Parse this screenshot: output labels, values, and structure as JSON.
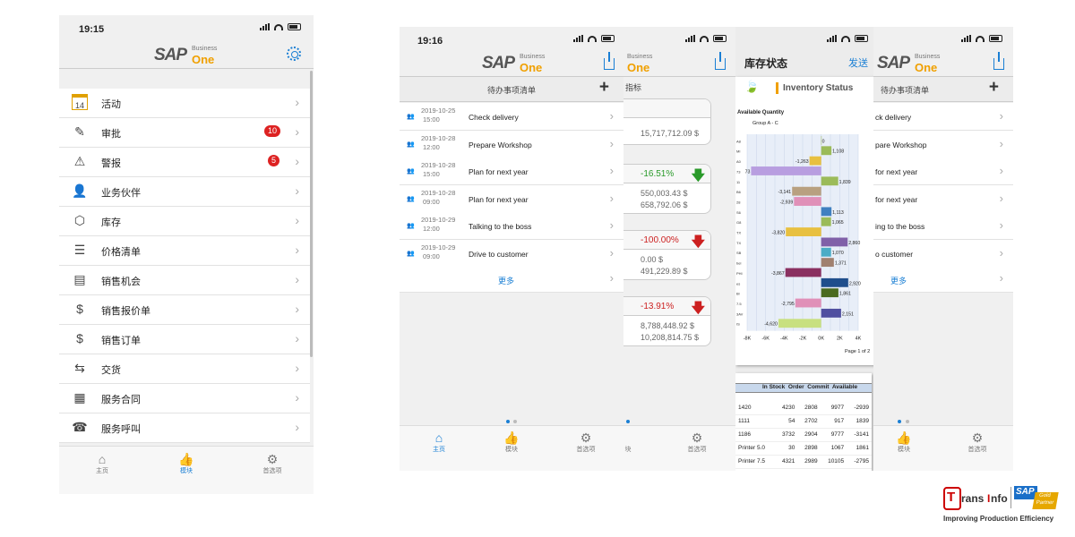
{
  "phone1": {
    "time": "19:15",
    "menu": [
      {
        "label": "活动",
        "icon": "calendar-icon",
        "badge": ""
      },
      {
        "label": "审批",
        "icon": "approval-icon",
        "badge": "10"
      },
      {
        "label": "警报",
        "icon": "warning-icon",
        "badge": "5"
      },
      {
        "label": "业务伙伴",
        "icon": "partner-icon",
        "badge": ""
      },
      {
        "label": "库存",
        "icon": "box-icon",
        "badge": ""
      },
      {
        "label": "价格清单",
        "icon": "price-list-icon",
        "badge": ""
      },
      {
        "label": "销售机会",
        "icon": "opportunity-icon",
        "badge": ""
      },
      {
        "label": "销售报价单",
        "icon": "quotation-icon",
        "badge": ""
      },
      {
        "label": "销售订单",
        "icon": "order-icon",
        "badge": ""
      },
      {
        "label": "交货",
        "icon": "delivery-icon",
        "badge": ""
      },
      {
        "label": "服务合同",
        "icon": "contract-icon",
        "badge": ""
      },
      {
        "label": "服务呼叫",
        "icon": "service-call-icon",
        "badge": ""
      }
    ],
    "tabs": [
      "主页",
      "模块",
      "首选项"
    ]
  },
  "logo": {
    "sap": "SAP",
    "business": "Business",
    "one": "One"
  },
  "phone2": {
    "time": "19:16",
    "header": "待办事项清单",
    "todos": [
      {
        "date": "2019-10-25",
        "time": "15:00",
        "text": "Check delivery"
      },
      {
        "date": "2019-10-28",
        "time": "12:00",
        "text": "Prepare Workshop"
      },
      {
        "date": "2019-10-28",
        "time": "15:00",
        "text": "Plan for next year"
      },
      {
        "date": "2019-10-28",
        "time": "09:00",
        "text": "Plan for next year"
      },
      {
        "date": "2019-10-29",
        "time": "12:00",
        "text": "Talking to the boss"
      },
      {
        "date": "2019-10-29",
        "time": "09:00",
        "text": "Drive to customer"
      }
    ],
    "more": "更多",
    "tabs": [
      "主页",
      "模块",
      "首选项"
    ]
  },
  "phone3": {
    "header": "指标",
    "first_value": "15,717,712.09 $",
    "kpis": [
      {
        "pct": "-16.51%",
        "v1": "550,003.43 $",
        "v2": "658,792.06 $",
        "color": "#2a9a2a"
      },
      {
        "pct": "-100.00%",
        "v1": "0.00 $",
        "v2": "491,229.89 $",
        "color": "#cc2020"
      },
      {
        "pct": "-13.91%",
        "v1": "8,788,448.92 $",
        "v2": "10,208,814.75 $",
        "color": "#cc2020"
      }
    ],
    "tabs": [
      "块",
      "首选项"
    ]
  },
  "phone4": {
    "title": "库存状态",
    "send": "发送",
    "report_title": "Inventory Status",
    "report_sub1": "Available Quantity",
    "report_sub2": "Group A - C",
    "page": "Page 1 of 2",
    "table_headers": [
      "In Stock",
      "Order",
      "Commit",
      "Available"
    ],
    "table_rows": [
      [
        "1420",
        "4230",
        "2808",
        "9977",
        "-2939"
      ],
      [
        "1111",
        "54",
        "2702",
        "917",
        "1839"
      ],
      [
        "1186",
        "3732",
        "2904",
        "9777",
        "-3141"
      ],
      [
        "Printer 5.0",
        "30",
        "2898",
        "1067",
        "1861"
      ],
      [
        "Printer 7.5",
        "4321",
        "2989",
        "10105",
        "-2795"
      ]
    ]
  },
  "phone5": {
    "header": "待办事项清单",
    "todos": [
      "ck delivery",
      "pare Workshop",
      "for next year",
      "for next year",
      "ing to the boss",
      "o customer"
    ],
    "more": "更多",
    "tabs": [
      "模块",
      "首选项"
    ]
  },
  "brand": {
    "name1": "rans",
    "name2": "nfo",
    "sap": "SAP",
    "gold": "Gold",
    "partner": "Partner",
    "tagline": "Improving Production Efficiency"
  },
  "chart_data": {
    "type": "bar",
    "orientation": "horizontal",
    "title": "",
    "xlabel": "",
    "ylabel": "",
    "xlim": [
      -8000,
      4000
    ],
    "x_ticks": [
      "-8K",
      "-6K",
      "-4K",
      "-2K",
      "0K",
      "2K",
      "4K"
    ],
    "categories": [
      "A8",
      "MI",
      "A0",
      "73",
      "11",
      "B6",
      "28",
      "S6",
      "G8",
      "TX",
      "TX",
      "SB",
      "bel",
      "PHI",
      "es",
      "Bl",
      "7.5",
      "3AV",
      "IS"
    ],
    "values": [
      0,
      1108,
      -1263,
      -7573,
      1839,
      -3141,
      -2939,
      1113,
      1065,
      -3820,
      2860,
      1070,
      1371,
      -3867,
      2920,
      1861,
      -2795,
      2151,
      -4620
    ],
    "value_labels": [
      "0",
      "1,108",
      "-1,263",
      "73",
      "1,839",
      "-3,141",
      "-2,939",
      "1,113",
      "1,065",
      "-3,820",
      "2,860",
      "1,070",
      "1,371",
      "-3,867",
      "2,920",
      "1,861",
      "-2,795",
      "2,151",
      "-4,620"
    ],
    "colors": [
      "#9bbb59",
      "#9bbb59",
      "#e8c040",
      "#b89ee0",
      "#9bbb59",
      "#b8a080",
      "#e090b8",
      "#4080c0",
      "#9bbb59",
      "#e8c040",
      "#8060a8",
      "#4bacc6",
      "#a08070",
      "#8a3060",
      "#1f4e8c",
      "#4a6a20",
      "#e090b8",
      "#5050a0",
      "#c8e080"
    ],
    "grid": true
  }
}
